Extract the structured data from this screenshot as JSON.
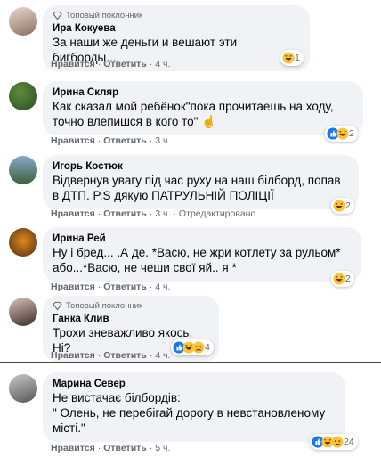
{
  "badge_label": "Топовый поклонник",
  "actions": {
    "like": "Нравится",
    "reply": "Ответить",
    "edited": "Отредактировано"
  },
  "comments": [
    {
      "author": "Ира Кокуева",
      "top_fan": true,
      "text": "За наши же деньги и вешают эти бигборды....",
      "time": "4 ч.",
      "reactions": [
        "haha"
      ],
      "count": "1"
    },
    {
      "author": "Ирина Скляр",
      "top_fan": false,
      "text": "Как сказал мой ребёнок\"пока прочитаешь на ходу, точно влепишся в кого то\" ☝",
      "time": "3 ч.",
      "reactions": [
        "like",
        "haha"
      ],
      "count": "2"
    },
    {
      "author": "Игорь Костюк",
      "top_fan": false,
      "text": "Відвернув увагу під час руху на наш білборд, попав в ДТП. P.S дякую ПАТРУЛЬНІЙ ПОЛІЦІЇ",
      "time": "3 ч.",
      "edited": true,
      "reactions": [
        "haha"
      ],
      "count": "2"
    },
    {
      "author": "Ирина Рей",
      "top_fan": false,
      "text": "Ну і бред... .А де. *Васю, не жри котлету за рульом* або...*Васю, не чеши свої яй.. я *",
      "time": "4 ч.",
      "reactions": [
        "haha"
      ],
      "count": "2"
    },
    {
      "author": "Ганка Клив",
      "top_fan": true,
      "text": "Трохи зневажливо якось. Ні?",
      "time": "4 ч.",
      "reactions": [
        "like",
        "haha",
        "sad"
      ],
      "count": "4"
    },
    {
      "author": "Марина Север",
      "top_fan": false,
      "text": "Не вистачає білбордів:\n\" Олень, не перебігай дорогу в невстановленому місті.\"",
      "time": "5 ч.",
      "reactions": [
        "like",
        "haha",
        "sad"
      ],
      "count": "24"
    }
  ]
}
